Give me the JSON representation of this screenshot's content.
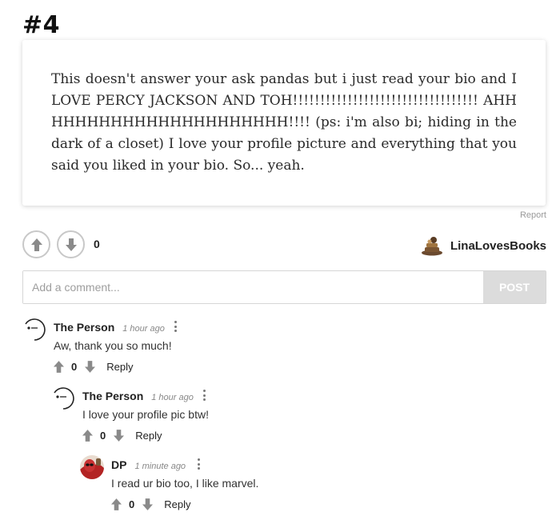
{
  "post": {
    "number": "#4",
    "body": "This doesn't answer your ask pandas but i just read your bio and I LOVE PERCY JACKSON AND TOH!!!!!!!!!!!!!!!!!!!!!!!!!!!!!!!!!! AHHHHHHHHHHHHHHHHHHHHHH!!!! (ps: i'm also bi; hiding in the dark of a closet) I love your profile picture and everything that you said you liked in your bio. So... yeah.",
    "report_label": "Report",
    "vote_count": "0",
    "author": "LinaLovesBooks"
  },
  "comment_form": {
    "placeholder": "Add a comment...",
    "post_label": "POST"
  },
  "comments": [
    {
      "author": "The Person",
      "time": "1 hour ago",
      "text": "Aw, thank you so much!",
      "votes": "0",
      "reply_label": "Reply"
    },
    {
      "author": "The Person",
      "time": "1 hour ago",
      "text": "I love your profile pic btw!",
      "votes": "0",
      "reply_label": "Reply"
    },
    {
      "author": "DP",
      "time": "1 minute ago",
      "text": "I read ur bio too, I like marvel.",
      "votes": "0",
      "reply_label": "Reply"
    }
  ],
  "icons": {
    "upvote": "arrow-up-icon",
    "downvote": "arrow-down-icon",
    "more": "more-vertical-icon"
  },
  "colors": {
    "vote_border": "#c8c8c8",
    "arrow_gray": "#8a8a8a",
    "post_button": "#dcdcdc"
  }
}
